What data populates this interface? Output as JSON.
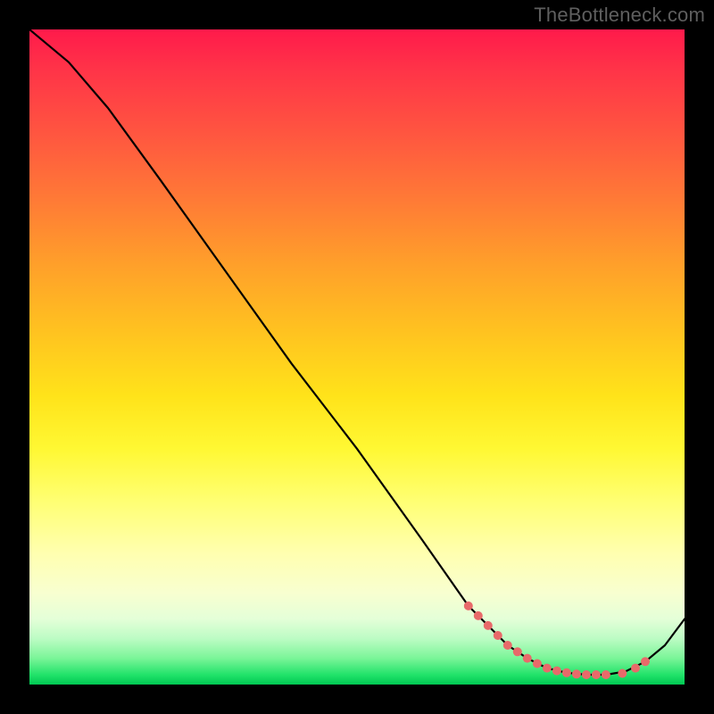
{
  "watermark": "TheBottleneck.com",
  "chart_data": {
    "type": "line",
    "title": "",
    "xlabel": "",
    "ylabel": "",
    "xlim": [
      0,
      100
    ],
    "ylim": [
      0,
      100
    ],
    "grid": false,
    "legend": false,
    "series": [
      {
        "name": "curve",
        "x": [
          0,
          6,
          12,
          20,
          30,
          40,
          50,
          60,
          67,
          70,
          73,
          76,
          79,
          82,
          85,
          88,
          91,
          94,
          97,
          100
        ],
        "values": [
          100,
          95,
          88,
          77,
          63,
          49,
          36,
          22,
          12,
          9,
          6,
          4,
          2.5,
          1.8,
          1.5,
          1.5,
          2.0,
          3.5,
          6.0,
          10
        ]
      }
    ],
    "highlight_dots": {
      "x": [
        67,
        68.5,
        70,
        71.5,
        73,
        74.5,
        76,
        77.5,
        79,
        80.5,
        82,
        83.5,
        85,
        86.5,
        88,
        90.5,
        92.5,
        94
      ],
      "values": [
        12,
        10.5,
        9,
        7.5,
        6,
        5,
        4,
        3.2,
        2.5,
        2.1,
        1.8,
        1.6,
        1.5,
        1.5,
        1.5,
        1.7,
        2.5,
        3.5
      ],
      "color": "#e86a6a",
      "radius": 5
    },
    "background_gradient": {
      "top": "#ff1a4b",
      "upper": "#ffa02a",
      "mid": "#ffe31a",
      "lower": "#ffffb0",
      "bottom": "#00c853"
    }
  }
}
